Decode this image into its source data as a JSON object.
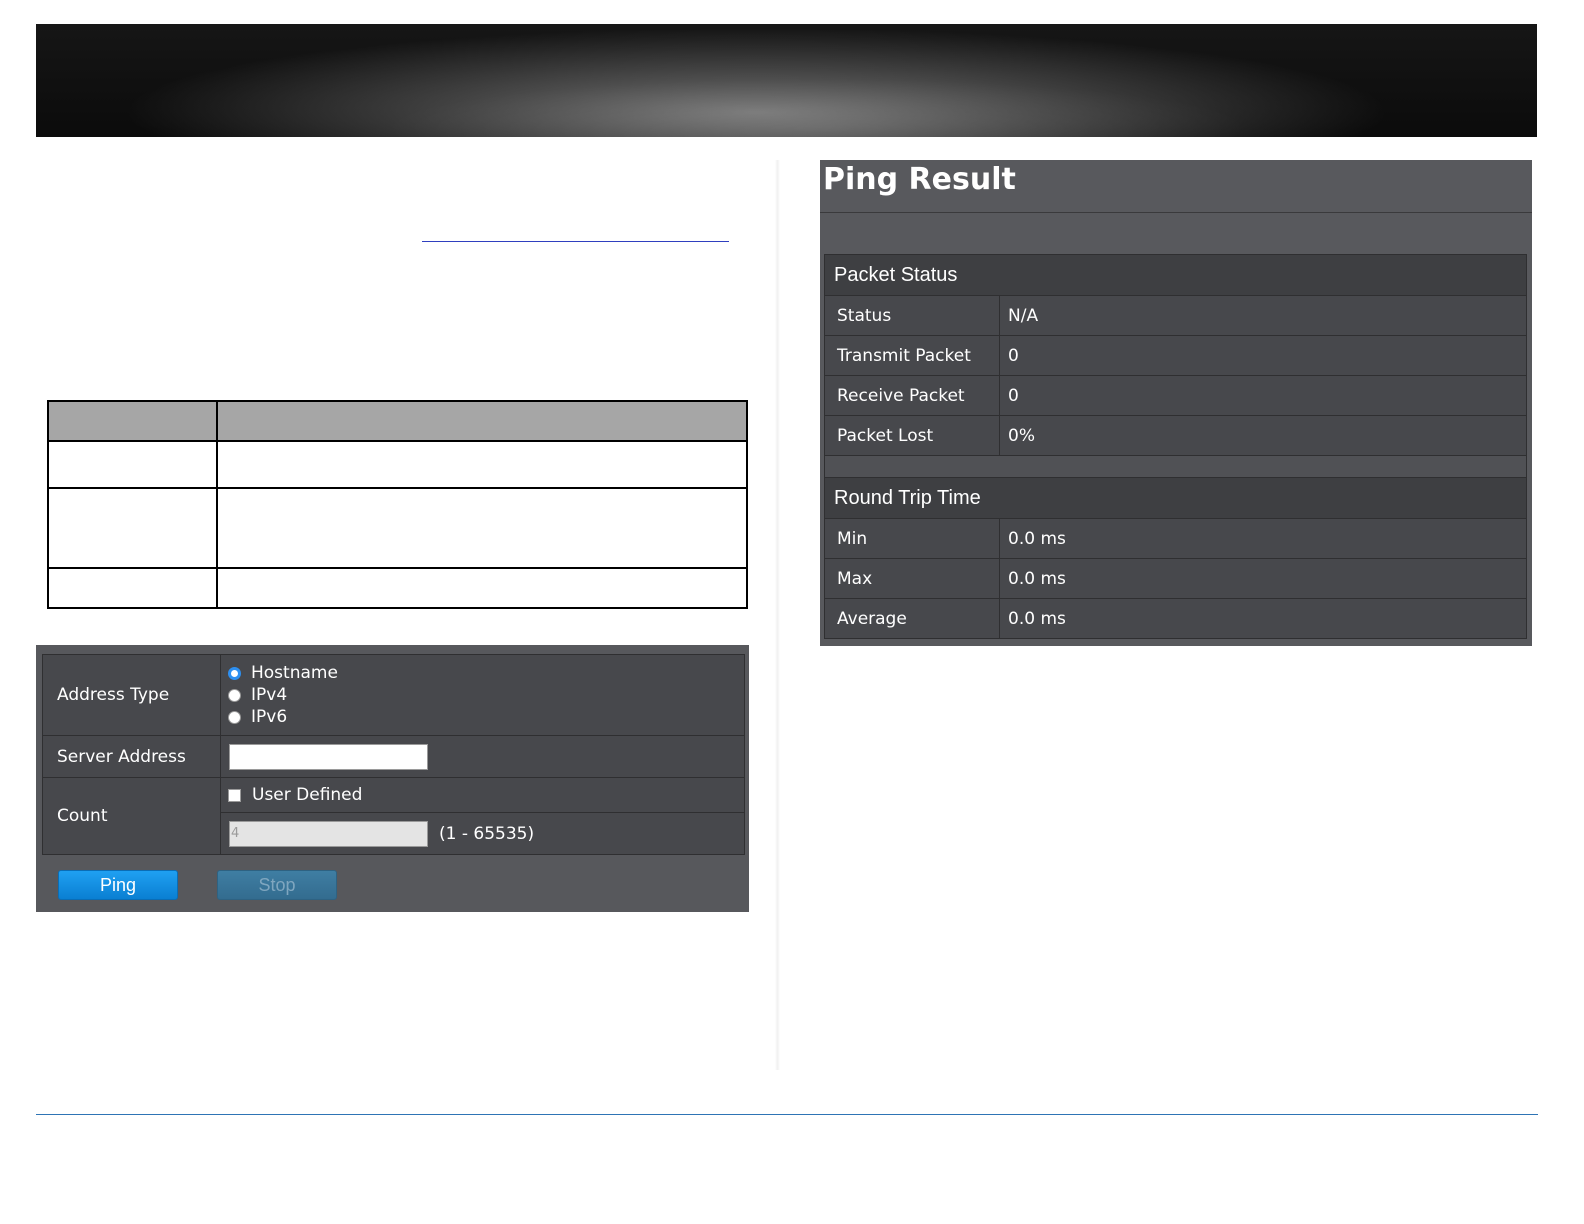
{
  "ping_form": {
    "address_type_label": "Address Type",
    "address_type_options": [
      "Hostname",
      "IPv4",
      "IPv6"
    ],
    "address_type_selected": "Hostname",
    "server_address_label": "Server Address",
    "server_address_value": "",
    "count_label": "Count",
    "user_defined_label": "User Defined",
    "user_defined_checked": false,
    "count_value": "4",
    "count_range": "(1 - 65535)",
    "ping_button": "Ping",
    "stop_button": "Stop"
  },
  "ping_result": {
    "title": "Ping Result",
    "packet_status_heading": "Packet Status",
    "packet_status": [
      {
        "label": "Status",
        "value": "N/A"
      },
      {
        "label": "Transmit Packet",
        "value": "0"
      },
      {
        "label": "Receive Packet",
        "value": "0"
      },
      {
        "label": "Packet Lost",
        "value": "0%"
      }
    ],
    "round_trip_heading": "Round Trip Time",
    "round_trip": [
      {
        "label": "Min",
        "value": "0.0 ms"
      },
      {
        "label": "Max",
        "value": "0.0 ms"
      },
      {
        "label": "Average",
        "value": "0.0 ms"
      }
    ]
  },
  "colors": {
    "panel_bg": "#58595d",
    "cell_bg": "#47484c",
    "section_bg": "#3e3f42",
    "ping_button": "#1294e6",
    "stop_button": "#3a7599",
    "footer_rule": "#2e74b5",
    "radio_selected": "#2d8ff0"
  }
}
